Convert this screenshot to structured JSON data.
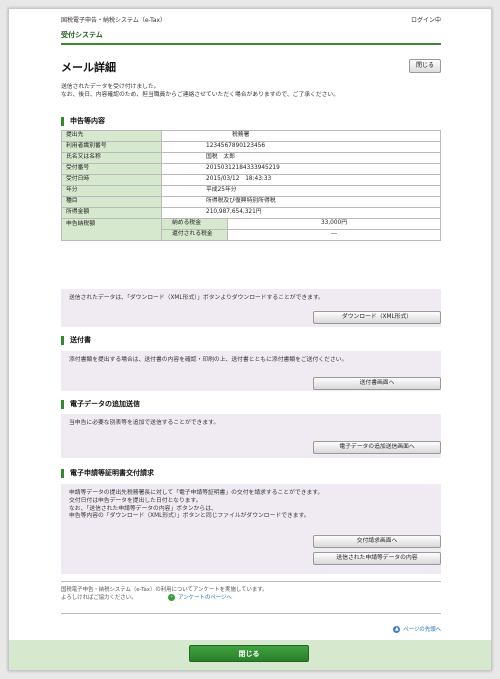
{
  "header": {
    "system_name": "国税電子申告・納税システム（e-Tax）",
    "login_status": "ログイン中",
    "sub_title": "受付システム"
  },
  "page": {
    "title": "メール詳細",
    "close_label": "閉じる",
    "intro_line1": "送信されたデータを受け付けました。",
    "intro_line2": "なお、後日、内容確認のため、担当職員からご連絡させていただく場合がありますので、ご了承ください。"
  },
  "declaration": {
    "heading": "申告等内容",
    "rows": [
      {
        "label": "提出先",
        "value": "税務署"
      },
      {
        "label": "利用者識別番号",
        "value": "1234567890123456"
      },
      {
        "label": "氏名又は名称",
        "value": "国税　太郎"
      },
      {
        "label": "受付番号",
        "value": "20150312184333945219"
      },
      {
        "label": "受付日時",
        "value": "2015/03/12　18:43:33"
      },
      {
        "label": "年分",
        "value": "平成25年分"
      },
      {
        "label": "種目",
        "value": "所得税及び復興特別所得税"
      },
      {
        "label": "所得金額",
        "value": "210,987,654,321円"
      }
    ],
    "tax_label": "申告納税額",
    "tax_rows": [
      {
        "label": "納める税金",
        "value": "33,000円"
      },
      {
        "label": "還付される税金",
        "value": "---"
      }
    ],
    "download_text": "送信されたデータは、「ダウンロード（XML形式）」ボタンよりダウンロードすることができます。",
    "download_button": "ダウンロード（XML形式）"
  },
  "attachment": {
    "heading": "送付書",
    "text": "添付書類を提出する場合は、送付書の内容を確認・印刷の上、送付書とともに添付書類をご送付ください。",
    "button": "送付書画面へ"
  },
  "additional": {
    "heading": "電子データの追加送信",
    "text": "当申告に必要な別表等を追加で送信することができます。",
    "button": "電子データの追加送信画面へ"
  },
  "certificate": {
    "heading": "電子申請等証明書交付請求",
    "line1": "申請等データの提出先税務署長に対して「電子申請等証明書」の交付を請求することができます。",
    "line2": "交付日付は申告データを提出した日付となります。",
    "line3": "なお、「送信された申請等データの内容」ボタンからは、",
    "line4": "申告等内容の「ダウンロード（XML形式）」ボタンと同じファイルがダウンロードできます。",
    "button1": "交付請求画面へ",
    "button2": "送信された申請等データの内容"
  },
  "footer": {
    "survey_text1": "国税電子申告・納税システム（e-Tax）の利用についてアンケートを実施しています。",
    "survey_text2": "よろしければご協力ください。",
    "survey_link": "アンケートのページへ",
    "page_top": "ページの先頭へ",
    "close_label": "閉じる"
  },
  "colors": {
    "accent_green": "#3a8b2c",
    "label_bg": "#d6e8cd",
    "box_bg": "#f0ebf2"
  }
}
